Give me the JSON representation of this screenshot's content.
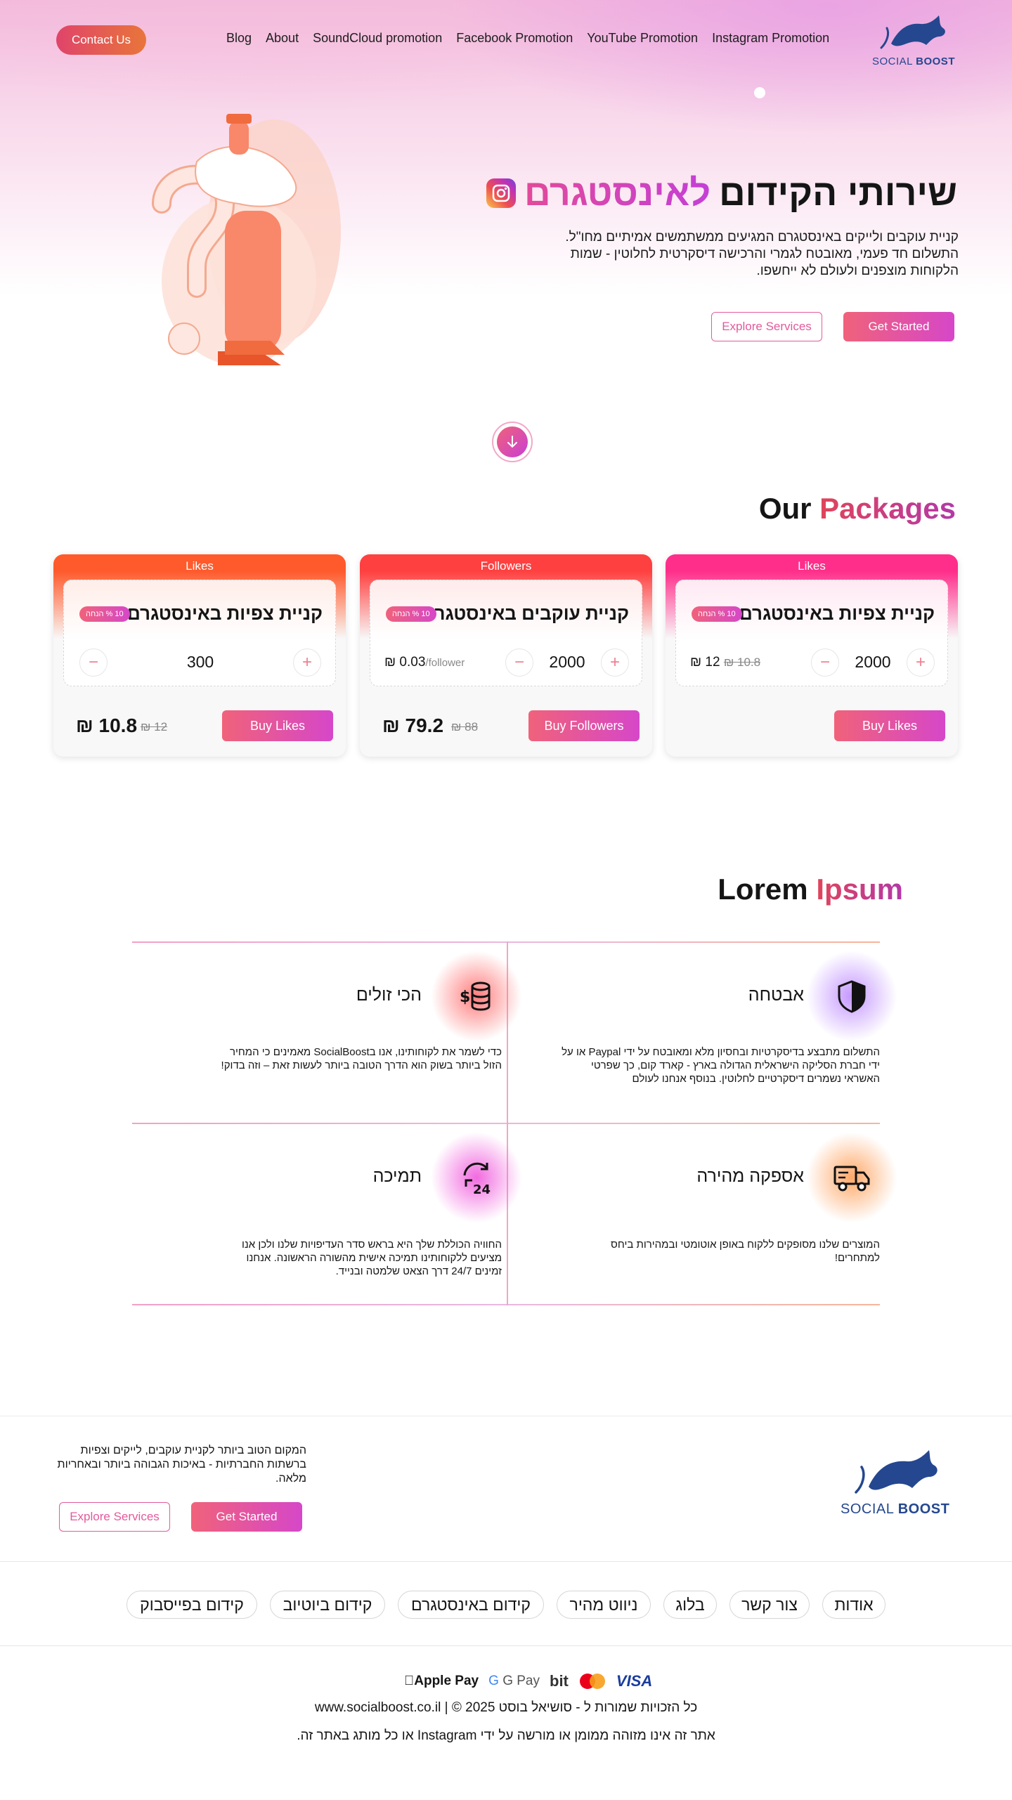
{
  "header": {
    "contact_label": "Contact Us",
    "nav": [
      "Blog",
      "About",
      "SoundCloud promotion",
      "Facebook Promotion",
      "YouTube Promotion",
      "Instagram Promotion"
    ],
    "logo": {
      "part1": "SOCIAL",
      "part2": "BOOST"
    }
  },
  "hero": {
    "title_plain": "שירותי הקידום",
    "title_accent": "לאינסטגרם",
    "description": "קניית עוקבים ולייקים באינסטגרם המגיעים ממשתמשים אמיתיים מחו\"ל. התשלום חד פעמי, מאובטח לגמרי והרכישה דיסקרטית לחלוטין - שמות הלקוחות מוצפנים ולעולם לא ייחשפו.",
    "explore_label": "Explore Services",
    "start_label": "Get Started"
  },
  "packages": {
    "title_plain": "Our",
    "title_accent": "Packages",
    "cards": [
      {
        "tag": "Likes",
        "title": "קניית צפיות באינסטגרם",
        "discount": "10 % הנחה",
        "qty": "300",
        "price": "₪ 10.8",
        "old_price": "₪ 12",
        "buy_label": "Buy Likes"
      },
      {
        "tag": "Followers",
        "title": "קניית עוקבים באינסטגרם",
        "discount": "10 % הנחה",
        "qty": "2000",
        "unit_price": "₪ 0.03",
        "unit_suffix": "/follower",
        "price": "₪ 79.2",
        "old_price": "₪ 88",
        "buy_label": "Buy Followers"
      },
      {
        "tag": "Likes",
        "title": "קניית צפיות באינסטגרם",
        "discount": "10 % הנחה",
        "qty": "2000",
        "unit_price": "₪ 12",
        "old_unit_price": "₪ 10.8",
        "buy_label": "Buy Likes"
      }
    ],
    "colors": {
      "orange": "#ff5a2c",
      "red": "#ff4040",
      "pink": "#ff2e8a"
    }
  },
  "features": {
    "title_plain": "Lorem",
    "title_accent": "Ipsum",
    "items": [
      {
        "title": "אבטחה",
        "icon": "shield-icon",
        "desc": "התשלום מתבצע בדיסקרטיות ובחסיון מלא ומאובטח על ידי Paypal או על ידי חברת הסליקה הישראלית הגדולה בארץ - קארד קום, כך שפרטי האשראי נשמרים דיסקרטיים לחלוטין. בנוסף אנחנו לעולם"
      },
      {
        "title": "הכי זולים",
        "icon": "coins-icon",
        "desc": "כדי לשמר את לקוחותינו, אנו בSocialBoost מאמינים כי המחיר הזול ביותר בשוק הוא הדרך הטובה ביותר לעשות זאת – וזה בדוק!"
      },
      {
        "title": "אספקה מהירה",
        "icon": "truck-icon",
        "desc": "המוצרים שלנו מסופקים ללקוח באופן אוטומטי ובמהירות ביחס למתחרים!"
      },
      {
        "title": "תמיכה",
        "icon": "support-24-icon",
        "desc": "החוויה הכוללת שלך היא בראש סדר העדיפויות שלנו ולכן אנו מציעים ללקוחותינו תמיכה אישית מהשורה הראשונה. אנחנו זמינים 24/7 דרך הצאט שלמטה ובנייד."
      }
    ]
  },
  "footer": {
    "logo": {
      "part1": "SOCIAL",
      "part2": "BOOST"
    },
    "desc": "המקום הטוב ביותר לקניית עוקבים, לייקים וצפיות ברשתות החברתיות - באיכות הגבוהה ביותר ובאחריות מלאה.",
    "explore_label": "Explore Services",
    "start_label": "Get Started",
    "links": [
      "אודות",
      "צור קשר",
      "בלוג",
      "ניווט מהיר",
      "קידום באינסטגרם",
      "קידום ביוטיוב",
      "קידום בפייסבוק"
    ],
    "payments": [
      "Apple Pay",
      "G Pay",
      "bit",
      "mastercard",
      "VISA"
    ],
    "copyright": "כל הזכויות שמורות ל - סושיאל בוסט 2025 © | www.socialboost.co.il",
    "disclaimer": "אתר זה אינו מזוהה ממומן או מורשה על ידי Instagram או כל מותג באתר זה."
  }
}
